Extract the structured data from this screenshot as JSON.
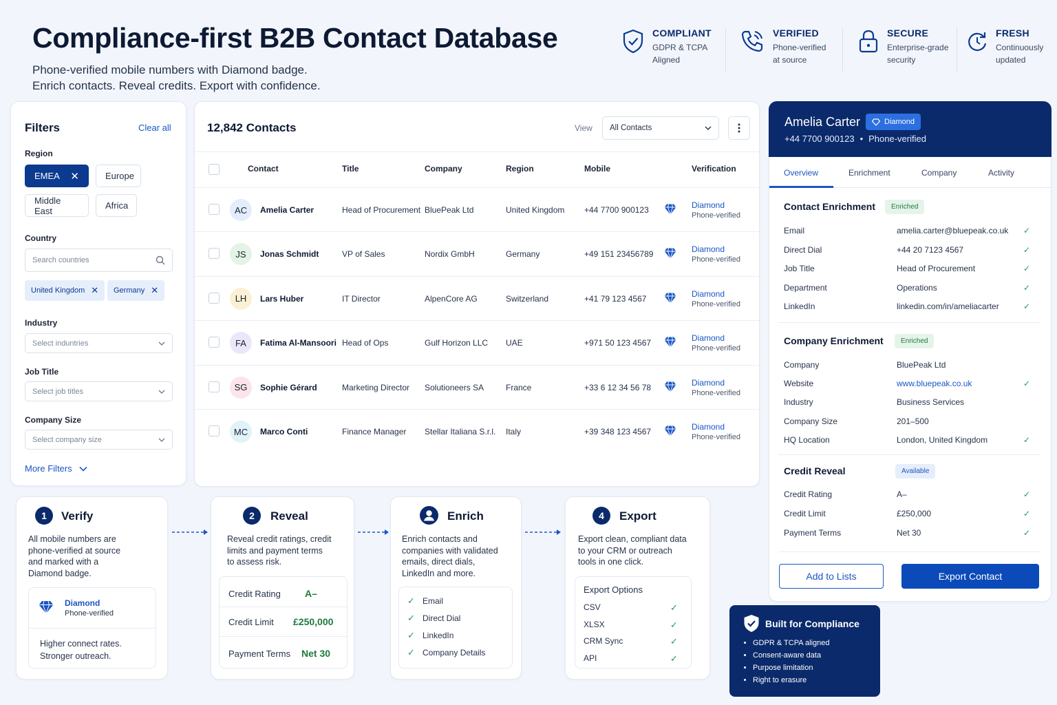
{
  "header": {
    "title": "Compliance-first B2B Contact Database",
    "subtitle_line1": "Phone-verified mobile numbers with Diamond badge.",
    "subtitle_line2": "Enrich contacts. Reveal credits. Export with confidence.",
    "badges": [
      {
        "icon": "shield-check-icon",
        "title": "COMPLIANT",
        "line1": "GDPR & TCPA",
        "line2": "Aligned"
      },
      {
        "icon": "phone-icon",
        "title": "VERIFIED",
        "line1": "Phone-verified",
        "line2": "at source"
      },
      {
        "icon": "lock-icon",
        "title": "SECURE",
        "line1": "Enterprise-grade",
        "line2": "security"
      },
      {
        "icon": "refresh-clock-icon",
        "title": "FRESH",
        "line1": "Continuously",
        "line2": "updated"
      }
    ]
  },
  "filters": {
    "title": "Filters",
    "clear_all": "Clear all",
    "region_label": "Region",
    "regions": [
      "EMEA",
      "Europe",
      "Middle East",
      "Africa"
    ],
    "country_label": "Country",
    "country_placeholder": "Search countries",
    "country_tags": [
      "United Kingdom",
      "Germany"
    ],
    "industry_label": "Industry",
    "industry_placeholder": "Select induntries",
    "job_title_label": "Job Title",
    "job_title_placeholder": "Select job titles",
    "company_size_label": "Company Size",
    "company_size_placeholder": "Select company size",
    "more_filters": "More Filters"
  },
  "table": {
    "count_label": "12,842 Contacts",
    "view_label": "View",
    "view_selected": "All Contacts",
    "columns": [
      "Contact",
      "Title",
      "Company",
      "Region",
      "Mobile",
      "Verification"
    ],
    "rows": [
      {
        "initials": "AC",
        "avatar_color": "#e3edfb",
        "name": "Amelia Carter",
        "title": "Head of Procurement",
        "company": "BluePeak Ltd",
        "region": "United Kingdom",
        "mobile": "+44 7700 900123",
        "verification": "Diamond",
        "verification_sub": "Phone-verified"
      },
      {
        "initials": "JS",
        "avatar_color": "#e3f4e6",
        "name": "Jonas Schmidt",
        "title": "VP of Sales",
        "company": "Nordix GmbH",
        "region": "Germany",
        "mobile": "+49 151 23456789",
        "verification": "Diamond",
        "verification_sub": "Phone-verified"
      },
      {
        "initials": "LH",
        "avatar_color": "#fbf0d4",
        "name": "Lars Huber",
        "title": "IT Director",
        "company": "AlpenCore AG",
        "region": "Switzerland",
        "mobile": "+41 79 123 4567",
        "verification": "Diamond",
        "verification_sub": "Phone-verified"
      },
      {
        "initials": "FA",
        "avatar_color": "#ebe7fa",
        "name": "Fatima Al-Mansoori",
        "title": "Head of Ops",
        "company": "Gulf Horizon LLC",
        "region": "UAE",
        "mobile": "+971 50 123 4567",
        "verification": "Diamond",
        "verification_sub": "Phone-verified"
      },
      {
        "initials": "SG",
        "avatar_color": "#fbe4ea",
        "name": "Sophie Gérard",
        "title": "Marketing Director",
        "company": "Solutioneers SA",
        "region": "France",
        "mobile": "+33 6 12 34 56 78",
        "verification": "Diamond",
        "verification_sub": "Phone-verified"
      },
      {
        "initials": "MC",
        "avatar_color": "#e0f3f8",
        "name": "Marco Conti",
        "title": "Finance Manager",
        "company": "Stellar Italiana S.r.l.",
        "region": "Italy",
        "mobile": "+39 348 123 4567",
        "verification": "Diamond",
        "verification_sub": "Phone-verified"
      }
    ]
  },
  "detail": {
    "name": "Amelia Carter",
    "badge": "Diamond",
    "phone": "+44 7700 900123",
    "phone_status": "Phone-verified",
    "tabs": [
      "Overview",
      "Enrichment",
      "Company",
      "Activity"
    ],
    "contact_enrichment": {
      "title": "Contact Enrichment",
      "status": "Enriched",
      "fields": [
        {
          "label": "Email",
          "value": "amelia.carter@bluepeak.co.uk",
          "check": true
        },
        {
          "label": "Direct Dial",
          "value": "+44 20 7123 4567",
          "check": true
        },
        {
          "label": "Job Title",
          "value": "Head of Procurement",
          "check": true
        },
        {
          "label": "Department",
          "value": "Operations",
          "check": true
        },
        {
          "label": "LinkedIn",
          "value": "linkedin.com/in/ameliacarter",
          "check": true
        }
      ]
    },
    "company_enrichment": {
      "title": "Company Enrichment",
      "status": "Enriched",
      "fields": [
        {
          "label": "Company",
          "value": "BluePeak Ltd",
          "check": false
        },
        {
          "label": "Website",
          "value": "www.bluepeak.co.uk",
          "check": true
        },
        {
          "label": "Industry",
          "value": "Business Services",
          "check": false
        },
        {
          "label": "Company Size",
          "value": "201–500",
          "check": false
        },
        {
          "label": "HQ Location",
          "value": "London, United Kingdom",
          "check": true
        }
      ]
    },
    "credit_reveal": {
      "title": "Credit Reveal",
      "status": "Available",
      "fields": [
        {
          "label": "Credit Rating",
          "value": "A–",
          "check": true
        },
        {
          "label": "Credit Limit",
          "value": "£250,000",
          "check": true
        },
        {
          "label": "Payment Terms",
          "value": "Net 30",
          "check": true
        }
      ]
    },
    "add_to_lists": "Add to Lists",
    "export_contact": "Export Contact"
  },
  "steps": [
    {
      "num": "1",
      "title": "Verify",
      "desc": [
        "All mobile numbers are",
        "phone-verified at source",
        "and marked with a",
        "Diamond badge."
      ],
      "badge_title": "Diamond",
      "badge_sub": "Phone-verified",
      "footer": [
        "Higher connect rates.",
        "Stronger outreach."
      ]
    },
    {
      "num": "2",
      "title": "Reveal",
      "desc": [
        "Reveal credit ratings, credit",
        "limits and payment terms",
        "to assess risk."
      ],
      "items": [
        {
          "label": "Credit Rating",
          "value": "A–"
        },
        {
          "label": "Credit Limit",
          "value": "£250,000"
        },
        {
          "label": "Payment Terms",
          "value": "Net 30"
        }
      ]
    },
    {
      "num": "",
      "title": "Enrich",
      "desc": [
        "Enrich contacts and",
        "companies with validated",
        "emails, direct dials,",
        "LinkedIn and more."
      ],
      "items": [
        "Email",
        "Direct Dial",
        "LinkedIn",
        "Company Details"
      ]
    },
    {
      "num": "4",
      "title": "Export",
      "desc": [
        "Export clean, compliant data",
        "to your CRM or outreach",
        "tools in one click."
      ],
      "options_title": "Export Options",
      "items": [
        "CSV",
        "XLSX",
        "CRM Sync",
        "API"
      ]
    }
  ],
  "compliance": {
    "title": "Built for Compliance",
    "items": [
      "GDPR & TCPA aligned",
      "Consent-aware data",
      "Purpose limitation",
      "Right to erasure"
    ]
  },
  "colors": {
    "navy": "#0a2a6b",
    "accent": "#1a56c4",
    "success": "#2a9a4e",
    "background": "#f2f6fc"
  }
}
